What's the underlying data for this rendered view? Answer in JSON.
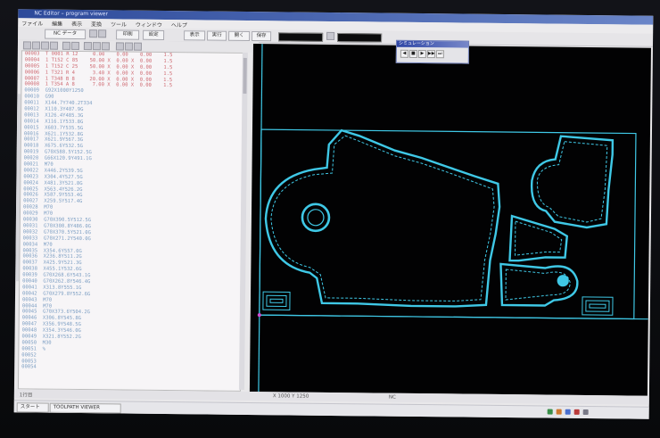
{
  "window": {
    "title": "NC Editor – program viewer"
  },
  "menu": {
    "items": [
      "ファイル",
      "編集",
      "表示",
      "変換",
      "ツール",
      "ウィンドウ",
      "ヘルプ"
    ]
  },
  "toolbar": {
    "buttons": [
      "開く",
      "保存",
      "印刷",
      "設定",
      "表示",
      "実行"
    ],
    "mode_select": "NC データ"
  },
  "code": {
    "lines": [
      "00003  T 0001 R 12     0.00    0.00    0.00    1.5",
      "00004  1 T152 C 85    50.00 X  0.00 X  0.00    1.5",
      "00005  1 T152 C 25    50.00 X  0.00 X  0.00    1.5",
      "00006  1 T321 R 4      3.40 X  0.00 X  0.00    1.5",
      "00007  1 T348 B 8     20.00 X  0.00 X  0.00    1.5",
      "00008  1 T354 A 8      7.00 X  0.00 X  0.00    1.5",
      "00009  G92X1000Y1250",
      "00010  G90",
      "00011  X144.7Y740.2T334",
      "00012  X110.3Y487.9G",
      "00013  X126.4Y485.3G",
      "00014  X116.1Y533.8G",
      "00015  X603.7Y535.5G",
      "00016  X621.1Y532.8G",
      "00017  X621.9Y567.3G",
      "00018  X675.6Y532.5G",
      "00019  G70X588.5Y152.5G",
      "00020  G66X120.9Y491.1G",
      "00021  M70",
      "00022  X446.2Y539.5G",
      "00023  X304.4Y527.5G",
      "00024  X481.3Y521.8G",
      "00025  X563.4Y526.2G",
      "00026  X587.9Y553.4G",
      "00027  X259.5Y517.4G",
      "00028  M70",
      "00029  M70",
      "00030  G70X390.5Y512.5G",
      "00031  G70X308.8Y486.0G",
      "00032  G70X370.5Y521.0G",
      "00033  G70X271.2Y540.0G",
      "00034  M70",
      "00035  X354.6Y557.0G",
      "00036  X236.8Y511.2G",
      "00037  X425.9Y521.3G",
      "00038  X455.1Y532.6G",
      "00039  G70X268.6Y543.1G",
      "00040  G70X262.8Y546.4G",
      "00041  X313.8Y555.1G",
      "00042  G70X279.8Y552.6G",
      "00043  M70",
      "00044  M70",
      "00045  G70X373.6Y504.2G",
      "00046  X306.8Y545.8G",
      "00047  X356.9Y548.5G",
      "00048  X354.3Y546.0G",
      "00049  X321.8Y552.2G",
      "00050  M30",
      "00051  %",
      "00052  ",
      "00053  ",
      "00054  "
    ]
  },
  "float_panel": {
    "title": "シミュレーション",
    "controls": [
      "◀",
      "■",
      "▶",
      "▶▶",
      "⏭"
    ]
  },
  "status": {
    "left": "1行目",
    "mid": "X 1000  Y 1250",
    "right": "NC"
  },
  "taskbar": {
    "start": "スタート",
    "tasks": [
      "TOOLPATH VIEWER"
    ],
    "clock": ""
  },
  "colors": {
    "drawing": "#3fc8e6",
    "canvas_bg": "#020203",
    "code_text": "#7fa0c4"
  }
}
